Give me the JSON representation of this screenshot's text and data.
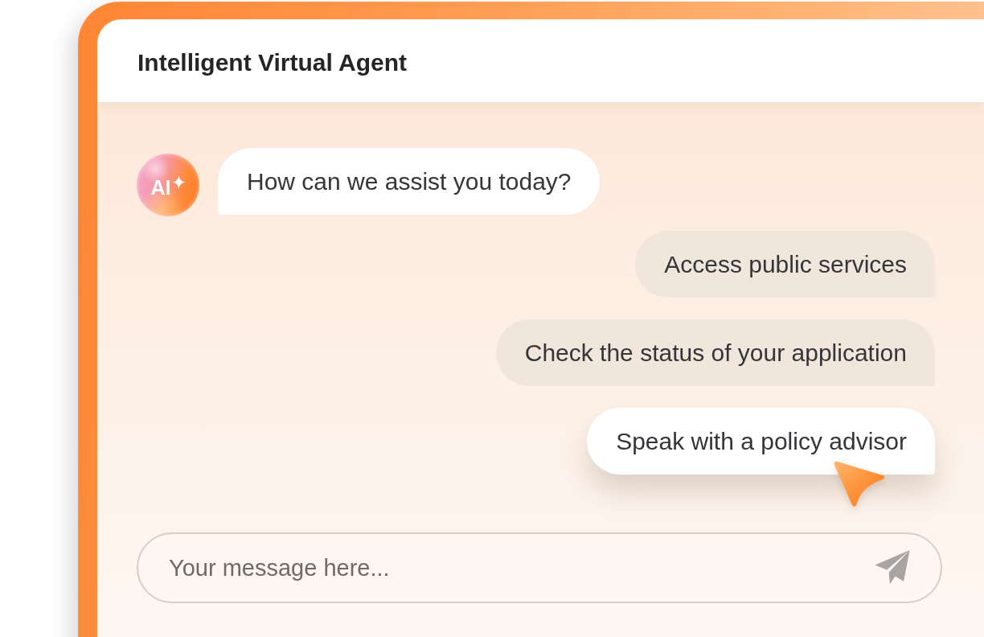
{
  "window": {
    "title": "Intelligent Virtual Agent"
  },
  "messages": [
    {
      "kind": "bot",
      "avatar_label": "AI",
      "text": "How can we assist you today?"
    }
  ],
  "options": [
    {
      "label": "Access public services",
      "selected": false
    },
    {
      "label": "Check the status of your application",
      "selected": false
    },
    {
      "label": "Speak with a policy advisor",
      "selected": true
    }
  ],
  "composer": {
    "placeholder": "Your message here..."
  }
}
